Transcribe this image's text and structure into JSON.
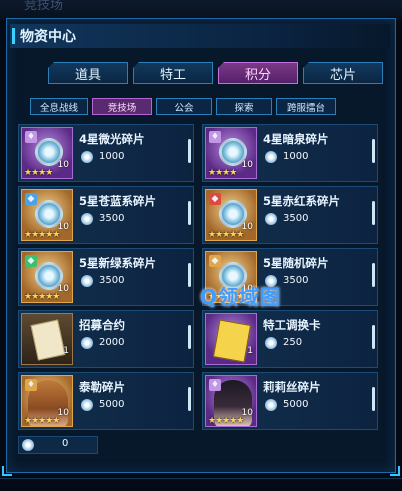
{
  "background_title": "竞技场",
  "panel": {
    "title": "物资中心"
  },
  "tabs": [
    {
      "label": "道具",
      "active": false
    },
    {
      "label": "特工",
      "active": false
    },
    {
      "label": "积分",
      "active": true
    },
    {
      "label": "芯片",
      "active": false
    }
  ],
  "subtabs": [
    {
      "label": "全息战线",
      "active": false
    },
    {
      "label": "竞技场",
      "active": true
    },
    {
      "label": "公会",
      "active": false
    },
    {
      "label": "探索",
      "active": false
    },
    {
      "label": "跨服擂台",
      "active": false
    }
  ],
  "items": [
    {
      "name": "4星微光碎片",
      "price": "1000",
      "qty": "10",
      "stars": "★★★★",
      "badge": "♦",
      "style": "purple"
    },
    {
      "name": "4星暗泉碎片",
      "price": "1000",
      "qty": "10",
      "stars": "★★★★",
      "badge": "♦",
      "style": "purple"
    },
    {
      "name": "5星苍蓝系碎片",
      "price": "3500",
      "qty": "10",
      "stars": "★★★★★",
      "badge": "◆",
      "style": "gold"
    },
    {
      "name": "5星赤红系碎片",
      "price": "3500",
      "qty": "10",
      "stars": "★★★★★",
      "badge": "◆",
      "style": "gold"
    },
    {
      "name": "5星新绿系碎片",
      "price": "3500",
      "qty": "10",
      "stars": "★★★★★",
      "badge": "◆",
      "style": "gold"
    },
    {
      "name": "5星随机碎片",
      "price": "3500",
      "qty": "10",
      "stars": "★★★★★",
      "badge": "◆",
      "style": "gold"
    },
    {
      "name": "招募合约",
      "price": "2000",
      "qty": "1",
      "stars": "",
      "badge": "",
      "style": "plain"
    },
    {
      "name": "特工调换卡",
      "price": "250",
      "qty": "1",
      "stars": "",
      "badge": "",
      "style": "purple"
    },
    {
      "name": "泰勒碎片",
      "price": "5000",
      "qty": "10",
      "stars": "★★★★★",
      "badge": "♦",
      "style": "gold"
    },
    {
      "name": "莉莉丝碎片",
      "price": "5000",
      "qty": "10",
      "stars": "★★★★★",
      "badge": "♦",
      "style": "purple"
    }
  ],
  "currency": {
    "value": "0"
  },
  "watermark": "Q领域图",
  "icons": {
    "currency": "arena-coin-icon"
  },
  "colors": {
    "accent": "#39d2ff",
    "active_tab": "#7b3a86",
    "stars": "#ffd34a"
  }
}
